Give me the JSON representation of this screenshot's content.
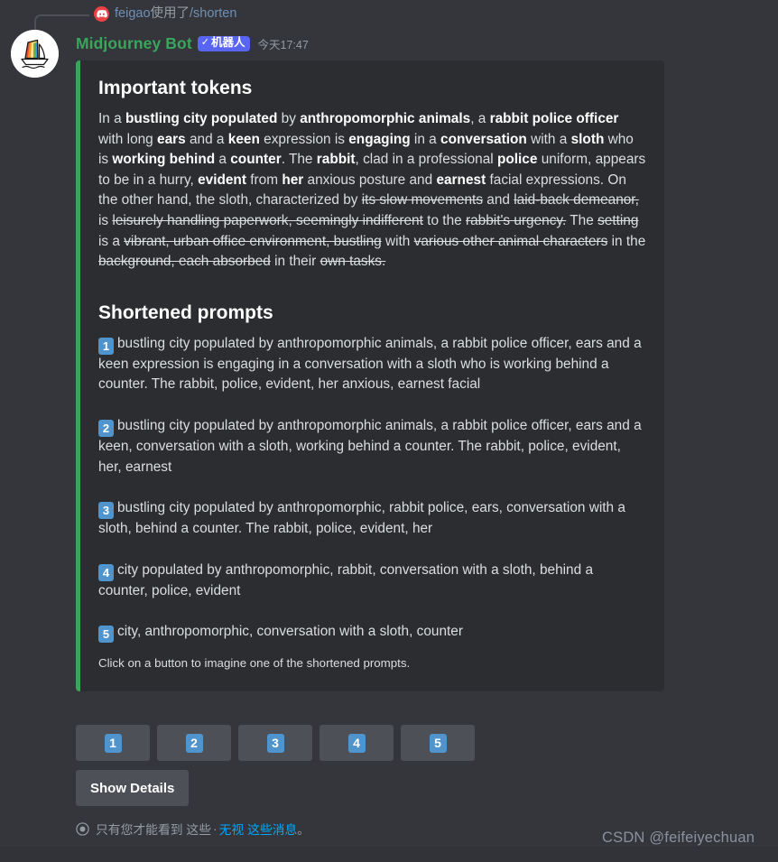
{
  "command_line": {
    "discord_icon": "discord-logo-icon",
    "user": "feigao",
    "used_text": "使用了",
    "command": "/shorten"
  },
  "author": {
    "avatar_icon": "midjourney-sailboat-avatar",
    "name": "Midjourney Bot",
    "bot_tag": "机器人",
    "bot_check": "✓",
    "timestamp": "今天17:47"
  },
  "embed": {
    "accent_color": "#3ba55c",
    "background_color": "#2b2d31",
    "important_tokens_title": "Important tokens",
    "important_tokens_segments": [
      {
        "text": "In a ",
        "bold": false,
        "strike": false
      },
      {
        "text": "bustling city populated",
        "bold": true,
        "strike": false
      },
      {
        "text": " by ",
        "bold": false,
        "strike": false
      },
      {
        "text": "anthropomorphic animals",
        "bold": true,
        "strike": false
      },
      {
        "text": ", a ",
        "bold": false,
        "strike": false
      },
      {
        "text": "rabbit police officer",
        "bold": true,
        "strike": false
      },
      {
        "text": " with long ",
        "bold": false,
        "strike": false
      },
      {
        "text": "ears",
        "bold": true,
        "strike": false
      },
      {
        "text": " and a ",
        "bold": false,
        "strike": false
      },
      {
        "text": "keen",
        "bold": true,
        "strike": false
      },
      {
        "text": " expression is ",
        "bold": false,
        "strike": false
      },
      {
        "text": "engaging",
        "bold": true,
        "strike": false
      },
      {
        "text": " in a ",
        "bold": false,
        "strike": false
      },
      {
        "text": "conversation",
        "bold": true,
        "strike": false
      },
      {
        "text": " with a ",
        "bold": false,
        "strike": false
      },
      {
        "text": "sloth",
        "bold": true,
        "strike": false
      },
      {
        "text": " who is ",
        "bold": false,
        "strike": false
      },
      {
        "text": "working behind",
        "bold": true,
        "strike": false
      },
      {
        "text": " a ",
        "bold": false,
        "strike": false
      },
      {
        "text": "counter",
        "bold": true,
        "strike": false
      },
      {
        "text": ". The ",
        "bold": false,
        "strike": false
      },
      {
        "text": "rabbit",
        "bold": true,
        "strike": false
      },
      {
        "text": ", clad in a professional ",
        "bold": false,
        "strike": false
      },
      {
        "text": "police",
        "bold": true,
        "strike": false
      },
      {
        "text": " uniform, appears to be in a hurry, ",
        "bold": false,
        "strike": false
      },
      {
        "text": "evident",
        "bold": true,
        "strike": false
      },
      {
        "text": " from ",
        "bold": false,
        "strike": false
      },
      {
        "text": "her",
        "bold": true,
        "strike": false
      },
      {
        "text": " anxious posture and ",
        "bold": false,
        "strike": false
      },
      {
        "text": "earnest",
        "bold": true,
        "strike": false
      },
      {
        "text": " facial expressions. On the other hand, the sloth, characterized by ",
        "bold": false,
        "strike": false
      },
      {
        "text": "its slow movements",
        "bold": false,
        "strike": true
      },
      {
        "text": " and ",
        "bold": false,
        "strike": false
      },
      {
        "text": "laid-back demeanor,",
        "bold": false,
        "strike": true
      },
      {
        "text": " is ",
        "bold": false,
        "strike": false
      },
      {
        "text": "leisurely handling paperwork, seemingly indifferent",
        "bold": false,
        "strike": true
      },
      {
        "text": " to the ",
        "bold": false,
        "strike": false
      },
      {
        "text": "rabbit's urgency.",
        "bold": false,
        "strike": true
      },
      {
        "text": " The ",
        "bold": false,
        "strike": false
      },
      {
        "text": "setting",
        "bold": false,
        "strike": true
      },
      {
        "text": " is a ",
        "bold": false,
        "strike": false
      },
      {
        "text": "vibrant, urban office environment, bustling",
        "bold": false,
        "strike": true
      },
      {
        "text": " with ",
        "bold": false,
        "strike": false
      },
      {
        "text": "various other animal characters",
        "bold": false,
        "strike": true
      },
      {
        "text": " in the ",
        "bold": false,
        "strike": false
      },
      {
        "text": "background, each absorbed",
        "bold": false,
        "strike": true
      },
      {
        "text": " in their ",
        "bold": false,
        "strike": false
      },
      {
        "text": "own tasks.",
        "bold": false,
        "strike": true
      }
    ],
    "shortened_prompts_title": "Shortened prompts",
    "prompts": [
      {
        "number": "1",
        "text": "bustling city populated by anthropomorphic animals, a rabbit police officer, ears and a keen expression is engaging in a conversation with a sloth who is working behind a counter. The rabbit, police, evident, her anxious, earnest facial"
      },
      {
        "number": "2",
        "text": "bustling city populated by anthropomorphic animals, a rabbit police officer, ears and a keen, conversation with a sloth, working behind a counter. The rabbit, police, evident, her, earnest"
      },
      {
        "number": "3",
        "text": "bustling city populated by anthropomorphic, rabbit police, ears, conversation with a sloth, behind a counter. The rabbit, police, evident, her"
      },
      {
        "number": "4",
        "text": "city populated by anthropomorphic, rabbit, conversation with a sloth, behind a counter, police, evident"
      },
      {
        "number": "5",
        "text": "city, anthropomorphic, conversation with a sloth, counter"
      }
    ],
    "footnote": "Click on a button to imagine one of the shortened prompts."
  },
  "action_buttons": {
    "numbered": [
      "1",
      "2",
      "3",
      "4",
      "5"
    ],
    "show_details_label": "Show Details"
  },
  "ephemeral": {
    "eye_icon": "eye-icon",
    "text_before": "只有您才能看到 这些",
    "separator": "·",
    "link_1": "无视",
    "link_2": "这些消息",
    "text_after": "。"
  },
  "watermark": "CSDN @feifeiyechuan"
}
